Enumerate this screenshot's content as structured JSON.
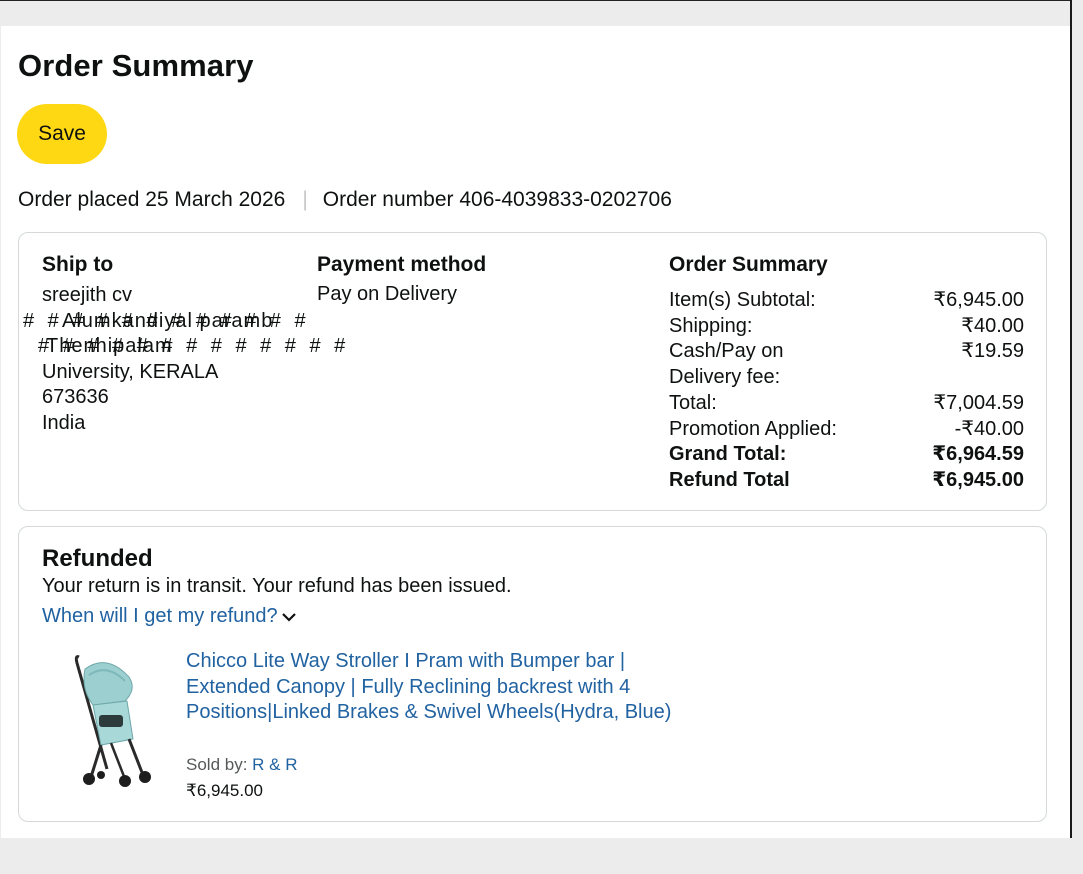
{
  "page": {
    "title": "Order Summary",
    "save_label": "Save"
  },
  "order": {
    "placed_text": "Order placed 25 March 2026",
    "separator": "|",
    "number_text": "Order number 406-4039833-0202706"
  },
  "ship_to": {
    "heading": "Ship to",
    "name": "sreejith cv",
    "line1_under": "Alumkandiyal paramb",
    "line1_mask": "# # # # # # # # # # # #",
    "line2_under": "Thenhipalam",
    "line2_mask": "# # # # # # # # # # # # #",
    "city_state": "University, KERALA",
    "postcode": "673636",
    "country": "India"
  },
  "payment": {
    "heading": "Payment method",
    "method": "Pay on Delivery"
  },
  "summary": {
    "heading": "Order Summary",
    "rows": [
      {
        "label": "Item(s) Subtotal:",
        "value": "₹6,945.00"
      },
      {
        "label": "Shipping:",
        "value": "₹40.00"
      },
      {
        "label": "Cash/Pay on Delivery fee:",
        "value": "₹19.59"
      },
      {
        "label": "Total:",
        "value": "₹7,004.59"
      },
      {
        "label": "Promotion Applied:",
        "value": "-₹40.00"
      },
      {
        "label": "Grand Total:",
        "value": "₹6,964.59"
      },
      {
        "label": "Refund Total",
        "value": "₹6,945.00"
      }
    ]
  },
  "refund": {
    "heading": "Refunded",
    "message": "Your return is in transit. Your refund has been issued.",
    "link_label": "When will I get my refund?",
    "link_icon": "chevron-down-icon"
  },
  "product": {
    "title": "Chicco Lite Way Stroller I Pram with Bumper bar | Extended Canopy | Fully Reclining backrest with 4 Positions|Linked Brakes & Swivel Wheels(Hydra, Blue)",
    "sold_by_label": "Sold by:",
    "seller": "R & R",
    "price": "₹6,945.00",
    "image_icon": "stroller-image"
  },
  "colors": {
    "save_button": "#ffd814",
    "link": "#2162a1",
    "card_border": "#d5d9d9",
    "background": "#ececec"
  }
}
